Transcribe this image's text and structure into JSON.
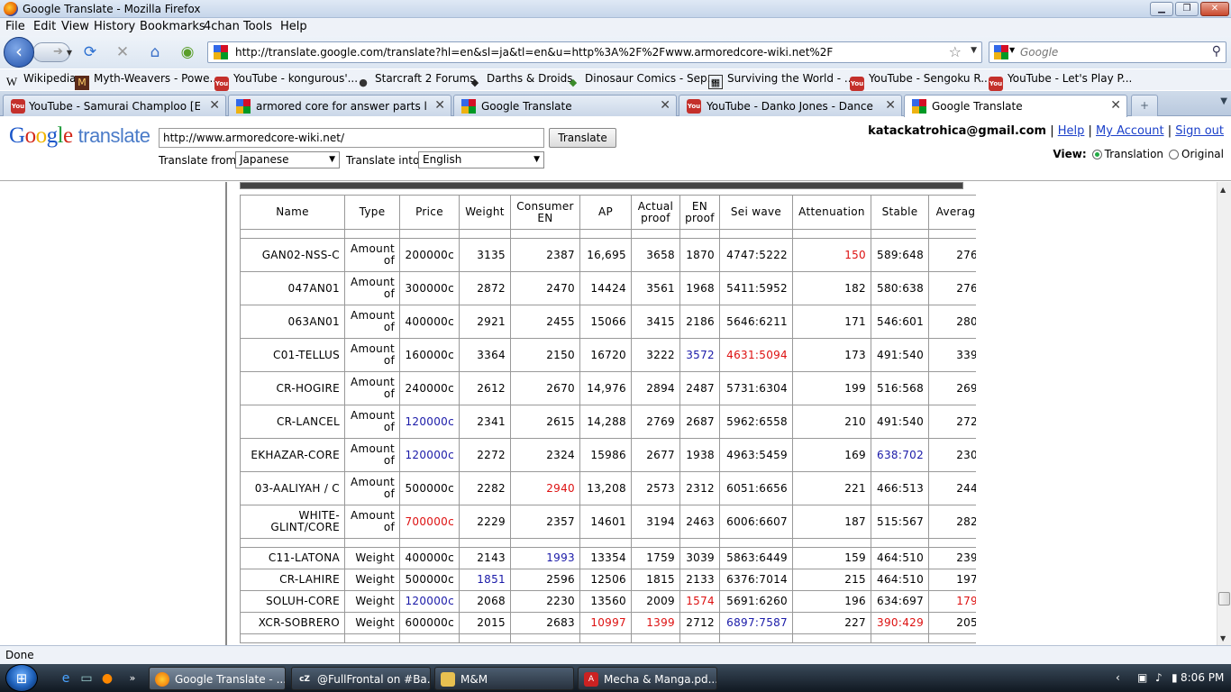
{
  "window": {
    "title": "Google Translate - Mozilla Firefox"
  },
  "menu": [
    "File",
    "Edit",
    "View",
    "History",
    "Bookmarks",
    "4chan",
    "Tools",
    "Help"
  ],
  "nav": {
    "url": "http://translate.google.com/translate?hl=en&sl=ja&tl=en&u=http%3A%2F%2Fwww.armoredcore-wiki.net%2F",
    "search_placeholder": "Google"
  },
  "bookmarks": [
    {
      "label": "Wikipedia",
      "icon": "W"
    },
    {
      "label": "Myth-Weavers - Powe...",
      "icon": "M"
    },
    {
      "label": "YouTube - kongurous'...",
      "icon": "You"
    },
    {
      "label": "Starcraft 2 Forums",
      "icon": "●"
    },
    {
      "label": "Darths & Droids",
      "icon": "◆"
    },
    {
      "label": "Dinosaur Comics - Sep...",
      "icon": "◆"
    },
    {
      "label": "Surviving the World - ...",
      "icon": "▦"
    },
    {
      "label": "YouTube - Sengoku R...",
      "icon": "You"
    },
    {
      "label": "YouTube - Let's Play P...",
      "icon": "You"
    }
  ],
  "tabs": [
    {
      "label": "YouTube - Samurai Champloo [Epis...",
      "icon": "You",
      "active": false
    },
    {
      "label": "armored core for answer parts list - ...",
      "icon": "G",
      "active": false
    },
    {
      "label": "Google Translate",
      "icon": "G",
      "active": false
    },
    {
      "label": "YouTube - Danko Jones - Dance",
      "icon": "You",
      "active": false
    },
    {
      "label": "Google Translate",
      "icon": "G",
      "active": true
    }
  ],
  "translate": {
    "logo_word": "translate",
    "url_value": "http://www.armoredcore-wiki.net/",
    "button": "Translate",
    "from_label": "Translate from:",
    "from_value": "Japanese",
    "into_label": "Translate into:",
    "into_value": "English",
    "email": "katackatrohica@gmail.com",
    "help": "Help",
    "my_account": "My Account",
    "sign_out": "Sign out",
    "view_label": "View:",
    "view_translation": "Translation",
    "view_original": "Original"
  },
  "table": {
    "headers": [
      "Name",
      "Type",
      "Price",
      "Weight",
      "Consumer EN",
      "AP",
      "Actual proof",
      "EN proof",
      "Sei wave",
      "Attenuation",
      "Stable",
      "Averag"
    ],
    "groups": [
      {
        "rows": [
          {
            "cells": [
              "GAN02-NSS-C",
              "Amount of",
              "200000c",
              "3135",
              "2387",
              "16,695",
              "3658",
              "1870",
              "4747:5222",
              "150",
              "589:648",
              "276"
            ],
            "colors": {
              "9": "red"
            }
          },
          {
            "cells": [
              "047AN01",
              "Amount of",
              "300000c",
              "2872",
              "2470",
              "14424",
              "3561",
              "1968",
              "5411:5952",
              "182",
              "580:638",
              "276"
            ],
            "colors": {}
          },
          {
            "cells": [
              "063AN01",
              "Amount of",
              "400000c",
              "2921",
              "2455",
              "15066",
              "3415",
              "2186",
              "5646:6211",
              "171",
              "546:601",
              "280"
            ],
            "colors": {}
          },
          {
            "cells": [
              "C01-TELLUS",
              "Amount of",
              "160000c",
              "3364",
              "2150",
              "16720",
              "3222",
              "3572",
              "4631:5094",
              "173",
              "491:540",
              "339"
            ],
            "colors": {
              "7": "blue",
              "8": "red"
            }
          },
          {
            "cells": [
              "CR-HOGIRE",
              "Amount of",
              "240000c",
              "2612",
              "2670",
              "14,976",
              "2894",
              "2487",
              "5731:6304",
              "199",
              "516:568",
              "269"
            ],
            "colors": {}
          },
          {
            "cells": [
              "CR-LANCEL",
              "Amount of",
              "120000c",
              "2341",
              "2615",
              "14,288",
              "2769",
              "2687",
              "5962:6558",
              "210",
              "491:540",
              "272"
            ],
            "colors": {
              "2": "blue"
            }
          },
          {
            "cells": [
              "EKHAZAR-CORE",
              "Amount of",
              "120000c",
              "2272",
              "2324",
              "15986",
              "2677",
              "1938",
              "4963:5459",
              "169",
              "638:702",
              "230"
            ],
            "colors": {
              "2": "blue",
              "10": "blue"
            }
          },
          {
            "cells": [
              "03-AALIYAH / C",
              "Amount of",
              "500000c",
              "2282",
              "2940",
              "13,208",
              "2573",
              "2312",
              "6051:6656",
              "221",
              "466:513",
              "244"
            ],
            "colors": {
              "4": "red"
            }
          },
          {
            "cells": [
              "WHITE-GLINT/CORE",
              "Amount of",
              "700000c",
              "2229",
              "2357",
              "14601",
              "3194",
              "2463",
              "6006:6607",
              "187",
              "515:567",
              "282"
            ],
            "colors": {
              "2": "red"
            }
          }
        ]
      },
      {
        "rows": [
          {
            "cells": [
              "C11-LATONA",
              "Weight",
              "400000c",
              "2143",
              "1993",
              "13354",
              "1759",
              "3039",
              "5863:6449",
              "159",
              "464:510",
              "239"
            ],
            "colors": {
              "4": "blue"
            }
          },
          {
            "cells": [
              "CR-LAHIRE",
              "Weight",
              "500000c",
              "1851",
              "2596",
              "12506",
              "1815",
              "2133",
              "6376:7014",
              "215",
              "464:510",
              "197"
            ],
            "colors": {
              "3": "blue"
            }
          },
          {
            "cells": [
              "SOLUH-CORE",
              "Weight",
              "120000c",
              "2068",
              "2230",
              "13560",
              "2009",
              "1574",
              "5691:6260",
              "196",
              "634:697",
              "179"
            ],
            "colors": {
              "2": "blue",
              "7": "red",
              "11": "red"
            }
          },
          {
            "cells": [
              "XCR-SOBRERO",
              "Weight",
              "600000c",
              "2015",
              "2683",
              "10997",
              "1399",
              "2712",
              "6897:7587",
              "227",
              "390:429",
              "205"
            ],
            "colors": {
              "5": "red",
              "6": "red",
              "8": "blue",
              "10": "red"
            }
          }
        ]
      }
    ]
  },
  "status": "Done",
  "taskbar": {
    "items": [
      {
        "label": "Google Translate - ...",
        "icon": "ff",
        "active": true
      },
      {
        "label": "@FullFrontal on #Ba...",
        "icon": "cZ",
        "active": false
      },
      {
        "label": "M&M",
        "icon": "fld",
        "active": false
      },
      {
        "label": "Mecha & Manga.pd...",
        "icon": "pdf",
        "active": false
      }
    ],
    "clock": "8:06 PM"
  }
}
